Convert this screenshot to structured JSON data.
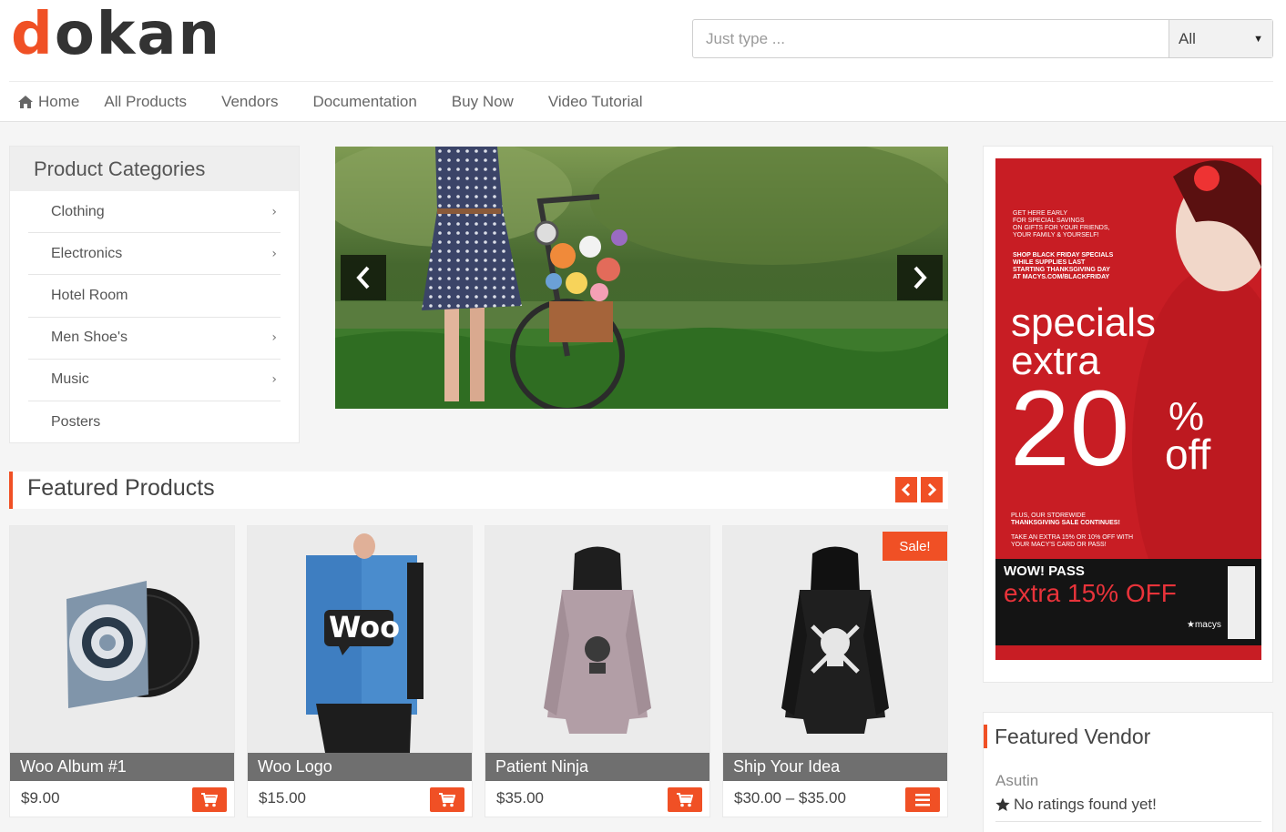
{
  "logo": {
    "first": "d",
    "rest": "okan"
  },
  "search": {
    "placeholder": "Just type ...",
    "filter": "All"
  },
  "nav": {
    "items": [
      "Home",
      "All Products",
      "Vendors",
      "Documentation",
      "Buy Now",
      "Video Tutorial"
    ]
  },
  "categories": {
    "title": "Product Categories",
    "items": [
      {
        "label": "Clothing",
        "has_children": true
      },
      {
        "label": "Electronics",
        "has_children": true
      },
      {
        "label": "Hotel Room",
        "has_children": false
      },
      {
        "label": "Men Shoe's",
        "has_children": true
      },
      {
        "label": "Music",
        "has_children": true
      },
      {
        "label": "Posters",
        "has_children": false
      }
    ]
  },
  "featured": {
    "title": "Featured Products",
    "products": [
      {
        "name": "Woo Album #1",
        "price": "$9.00",
        "action_icon": "cart-icon"
      },
      {
        "name": "Woo Logo",
        "price": "$15.00",
        "action_icon": "cart-icon"
      },
      {
        "name": "Patient Ninja",
        "price": "$35.00",
        "action_icon": "cart-icon"
      },
      {
        "name": "Ship Your Idea",
        "price": "$30.00 – $35.00",
        "action_icon": "menu-icon",
        "badge": "Sale!"
      }
    ]
  },
  "ad": {
    "intro": [
      "GET HERE EARLY",
      "FOR SPECIAL SAVINGS",
      "ON GIFTS FOR YOUR FRIENDS,",
      "YOUR FAMILY & YOURSELF!"
    ],
    "shop": [
      "SHOP BLACK FRIDAY SPECIALS",
      "WHILE SUPPLIES LAST",
      "STARTING THANKSGIVING DAY",
      "AT MACYS.COM/BLACKFRIDAY"
    ],
    "headline1": "specials",
    "headline2": "extra",
    "percent": "20",
    "pct_sign": "%",
    "off": "off",
    "plus": [
      "PLUS, OUR STOREWIDE",
      "THANKSGIVING SALE CONTINUES!"
    ],
    "take": [
      "TAKE AN EXTRA 15% OR 10% OFF WITH",
      "YOUR MACY'S CARD OR PASS!"
    ],
    "pass_title": "WOW! PASS",
    "pass_offer": "extra 15% OFF",
    "pass_brand": "★macys"
  },
  "vendor": {
    "title": "Featured Vendor",
    "name": "Asutin",
    "rating": "No ratings found yet!"
  },
  "colors": {
    "accent": "#f05025"
  }
}
